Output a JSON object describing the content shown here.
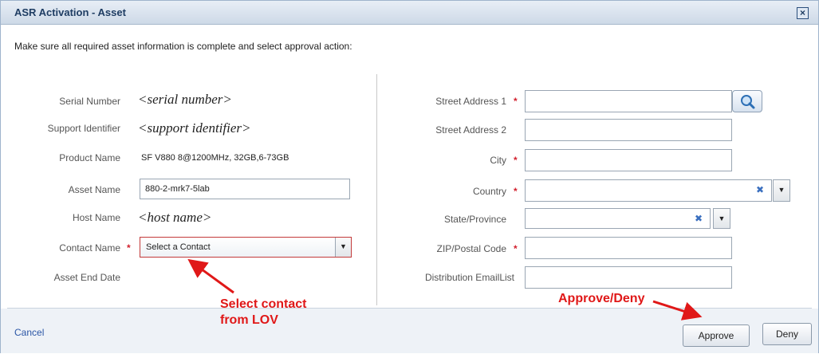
{
  "dialog": {
    "title": "ASR Activation - Asset",
    "instructions": "Make sure all required asset information is complete and select approval action:"
  },
  "left": {
    "serial_number": {
      "label": "Serial Number",
      "value": "<serial number>"
    },
    "support_identifier": {
      "label": "Support Identifier",
      "value": "<support identifier>"
    },
    "product_name": {
      "label": "Product Name",
      "value": "SF V880 8@1200MHz, 32GB,6-73GB"
    },
    "asset_name": {
      "label": "Asset Name",
      "value": "880-2-mrk7-5lab"
    },
    "host_name": {
      "label": "Host Name",
      "value": "<host name>"
    },
    "contact_name": {
      "label": "Contact Name",
      "value": "Select a Contact",
      "required": true
    },
    "asset_end_date": {
      "label": "Asset End Date"
    }
  },
  "right": {
    "street_address_1": {
      "label": "Street Address 1",
      "value": "",
      "required": true
    },
    "street_address_2": {
      "label": "Street Address 2",
      "value": ""
    },
    "city": {
      "label": "City",
      "value": "",
      "required": true
    },
    "country": {
      "label": "Country",
      "value": "",
      "required": true
    },
    "state_province": {
      "label": "State/Province",
      "value": ""
    },
    "zip_postal_code": {
      "label": "ZIP/Postal Code",
      "value": "",
      "required": true
    },
    "distribution_emaillist": {
      "label": "Distribution EmailList",
      "value": ""
    }
  },
  "required_marker": "*",
  "footer": {
    "cancel_label": "Cancel",
    "approve_label": "Approve",
    "deny_label": "Deny"
  },
  "annotations": {
    "select_contact_line1": "Select contact",
    "select_contact_line2": "from LOV",
    "approve_deny": "Approve/Deny"
  },
  "icons": {
    "close": "close-icon",
    "search": "search-icon",
    "clear": "clear-icon",
    "dropdown": "chevron-down-icon"
  },
  "colors": {
    "title": "#1f3d63",
    "required": "#d21f2d",
    "annotation": "#e01818",
    "link": "#2b56a6"
  }
}
